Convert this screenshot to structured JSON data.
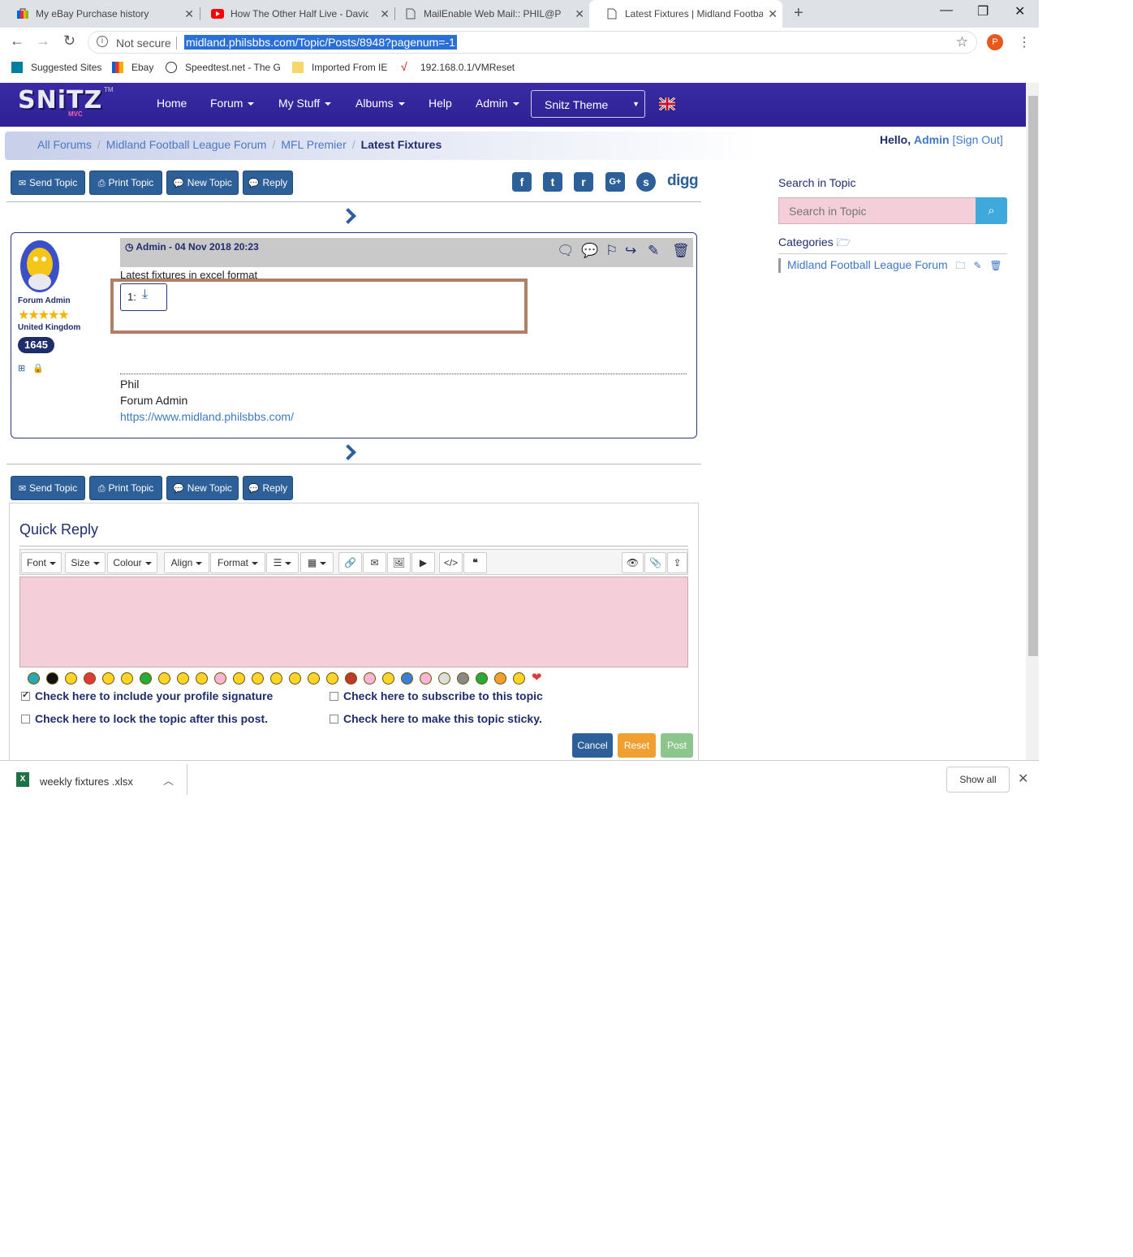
{
  "browser": {
    "tabs": [
      {
        "title": "My eBay Purchase history"
      },
      {
        "title": "How The Other Half Live - David"
      },
      {
        "title": "MailEnable Web Mail:: PHIL@PHI"
      },
      {
        "title": "Latest Fixtures | Midland Footbal"
      }
    ],
    "new_tab": "+",
    "address": {
      "security": "Not secure",
      "url": "midland.philsbbs.com/Topic/Posts/8948?pagenum=-1"
    },
    "profile_initial": "P",
    "bookmarks": [
      "Suggested Sites",
      "Ebay",
      "Speedtest.net - The G",
      "Imported From IE",
      "192.168.0.1/VMReset"
    ]
  },
  "site": {
    "logo": {
      "text": "SNiTZ",
      "sub": "MVC",
      "tm": "TM"
    },
    "nav": [
      "Home",
      "Forum",
      "My Stuff",
      "Albums",
      "Help",
      "Admin"
    ],
    "theme_select": "Snitz Theme",
    "accent": "#2d5f99",
    "navbar_color": "#3a2ba4"
  },
  "breadcrumb": {
    "items": [
      "All Forums",
      "Midland Football League Forum",
      "MFL Premier"
    ],
    "current": "Latest Fixtures"
  },
  "user": {
    "greeting": "Hello,",
    "name": "Admin",
    "sign_out": "[Sign Out]"
  },
  "buttons": {
    "send_topic": "Send Topic",
    "print_topic": "Print Topic",
    "new_topic": "New Topic",
    "reply": "Reply"
  },
  "social": {
    "digg": "digg",
    "googleplus": "G+"
  },
  "post": {
    "author_meta": "Admin -  04 Nov 2018 20:23",
    "member_title": "Forum Admin",
    "member_country": "United Kingdom",
    "post_count": "1645",
    "body": "Latest fixtures in excel format",
    "attachment_label": "1:",
    "signature": {
      "name": "Phil",
      "title": "Forum Admin",
      "link": "https://www.midland.philsbbs.com/"
    }
  },
  "quick_reply": {
    "title": "Quick Reply",
    "toolbar": {
      "font": "Font",
      "size": "Size",
      "colour": "Colour",
      "align": "Align",
      "format": "Format"
    },
    "options": {
      "signature": "Check here to include your profile signature",
      "subscribe": "Check here to subscribe to this topic",
      "lock": "Check here to lock the topic after this post.",
      "sticky": "Check here to make this topic sticky."
    },
    "signature_checked": true,
    "actions": {
      "cancel": "Cancel",
      "reset": "Reset",
      "post": "Post"
    }
  },
  "sidebar": {
    "search_label": "Search in Topic",
    "search_placeholder": "Search in Topic",
    "categories_label": "Categories",
    "category_item": "Midland Football League Forum"
  },
  "download_bar": {
    "filename": "weekly fixtures .xlsx",
    "show_all": "Show all"
  }
}
